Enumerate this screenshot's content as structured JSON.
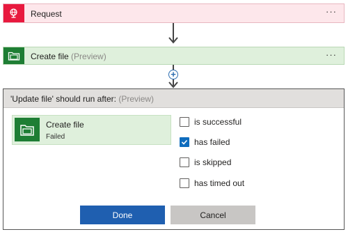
{
  "trigger": {
    "title": "Request",
    "icon": "globe-icon",
    "accent": "#e8193e",
    "more_label": "···"
  },
  "action": {
    "title": "Create file",
    "preview": "(Preview)",
    "icon": "folder-icon",
    "accent": "#1e7e34",
    "more_label": "···"
  },
  "insert_step": {
    "label": "+"
  },
  "run_after_dialog": {
    "header": "'Update file' should run after:",
    "header_preview": "(Preview)",
    "tile": {
      "name": "Create file",
      "status": "Failed",
      "icon": "folder-icon"
    },
    "options": [
      {
        "label": "is successful",
        "checked": false
      },
      {
        "label": "has failed",
        "checked": true
      },
      {
        "label": "is skipped",
        "checked": false
      },
      {
        "label": "has timed out",
        "checked": false
      }
    ],
    "done_label": "Done",
    "cancel_label": "Cancel"
  }
}
